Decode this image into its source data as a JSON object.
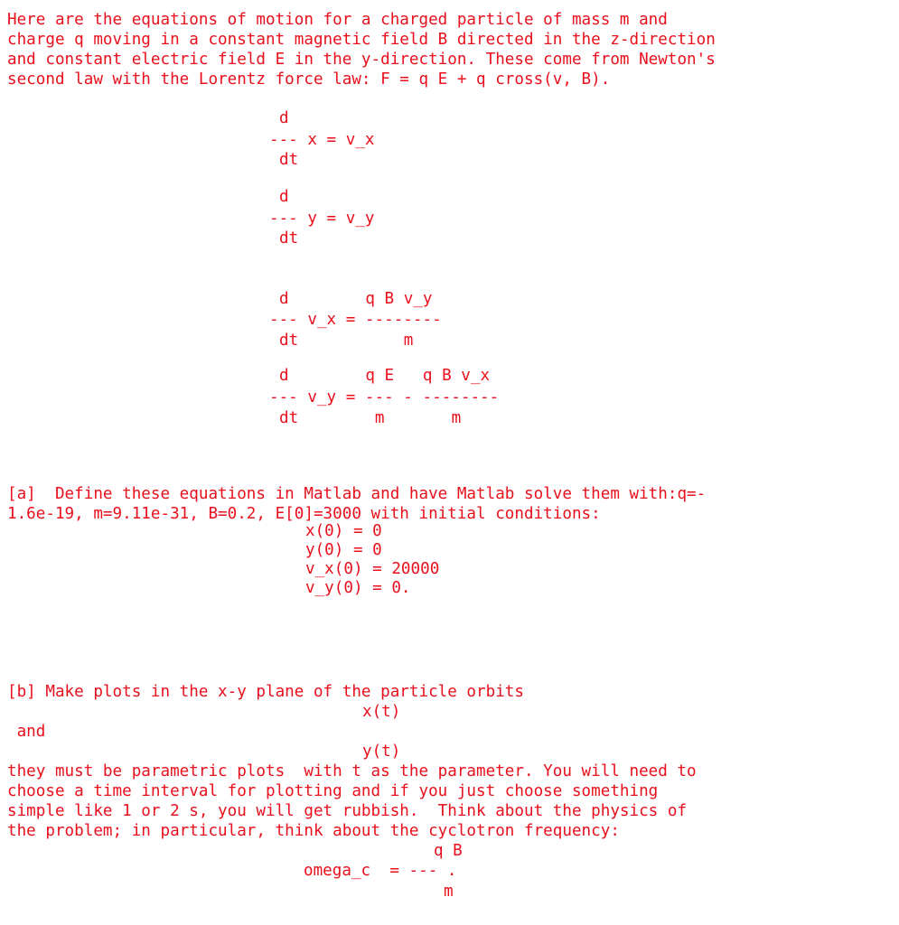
{
  "intro": {
    "lines": [
      "Here are the equations of motion for a charged particle of mass m and",
      "charge q moving in a constant magnetic field B directed in the z-direction",
      "and constant electric field E in the y-direction. These come from Newton's",
      "second law with the Lorentz force law: F = q E + q cross(v, B)."
    ]
  },
  "equations": {
    "eq1": {
      "num": "d",
      "bar": "--- x = v_x",
      "den": "dt"
    },
    "eq2": {
      "num": "d",
      "bar": "--- y = v_y",
      "den": "dt"
    },
    "eq3": {
      "num": "d        q B v_y",
      "bar": "--- v_x = --------",
      "den": "dt           m"
    },
    "eq4": {
      "num": "d        q E   q B v_x",
      "bar": "--- v_y = --- - --------",
      "den": "dt        m       m"
    }
  },
  "part_a": {
    "lines": [
      "[a]  Define these equations in Matlab and have Matlab solve them with:q=-",
      "1.6e-19, m=9.11e-31, B=0.2, E[0]=3000 with initial conditions:"
    ],
    "conditions": [
      "x(0) = 0",
      "y(0) = 0",
      "v_x(0) = 20000",
      "v_y(0) = 0."
    ]
  },
  "part_b": {
    "line1": "[b] Make plots in the x-y plane of the particle orbits",
    "xt": "x(t)",
    "and": " and",
    "yt": "y(t)",
    "lines": [
      "they must be parametric plots  with t as the parameter. You will need to",
      "choose a time interval for plotting and if you just choose something",
      "simple like 1 or 2 s, you will get rubbish.  Think about the physics of",
      "the problem; in particular, think about the cyclotron frequency:"
    ],
    "omega": {
      "num": "q B",
      "bar": "omega_c  = --- .",
      "den": "m"
    }
  }
}
